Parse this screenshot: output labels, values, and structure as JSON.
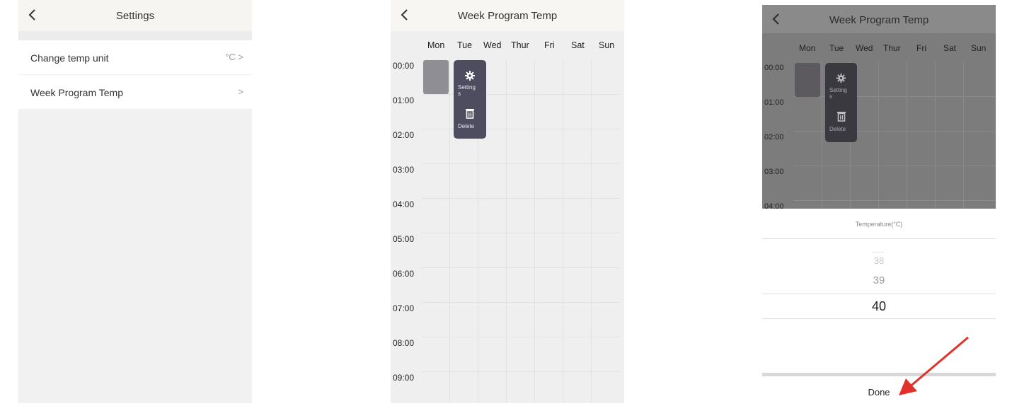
{
  "settings_screen": {
    "title": "Settings",
    "rows": [
      {
        "label": "Change temp unit",
        "value": "°C",
        "chevron": ">"
      },
      {
        "label": "Week Program Temp",
        "value": "",
        "chevron": ">"
      }
    ]
  },
  "week_program_screen": {
    "title": "Week Program Temp",
    "days": [
      "Mon",
      "Tue",
      "Wed",
      "Thur",
      "Fri",
      "Sat",
      "Sun"
    ],
    "times": [
      "00:00",
      "01:00",
      "02:00",
      "03:00",
      "04:00",
      "05:00",
      "06:00",
      "07:00",
      "08:00",
      "09:00"
    ],
    "popup": {
      "settings_icon": "gear-icon",
      "settings_label": "Setting",
      "settings_label_wrap": "s",
      "delete_icon": "trash-icon",
      "delete_label": "Delete"
    }
  },
  "temp_picker_screen": {
    "title": "Week Program Temp",
    "days": [
      "Mon",
      "Tue",
      "Wed",
      "Thur",
      "Fri",
      "Sat",
      "Sun"
    ],
    "times": [
      "00:00",
      "01:00",
      "02:00",
      "03:00",
      "04:00"
    ],
    "popup": {
      "settings_label": "Setting",
      "settings_label_wrap": "s",
      "delete_label": "Delete"
    },
    "picker_title": "Temperature(°C)",
    "options": [
      "38",
      "39",
      "40"
    ],
    "selected": "40",
    "done_label": "Done"
  },
  "colors": {
    "popup_bg": "#4e4c5f",
    "block_bg": "#8f8e95",
    "arrow": "#e0322a"
  }
}
